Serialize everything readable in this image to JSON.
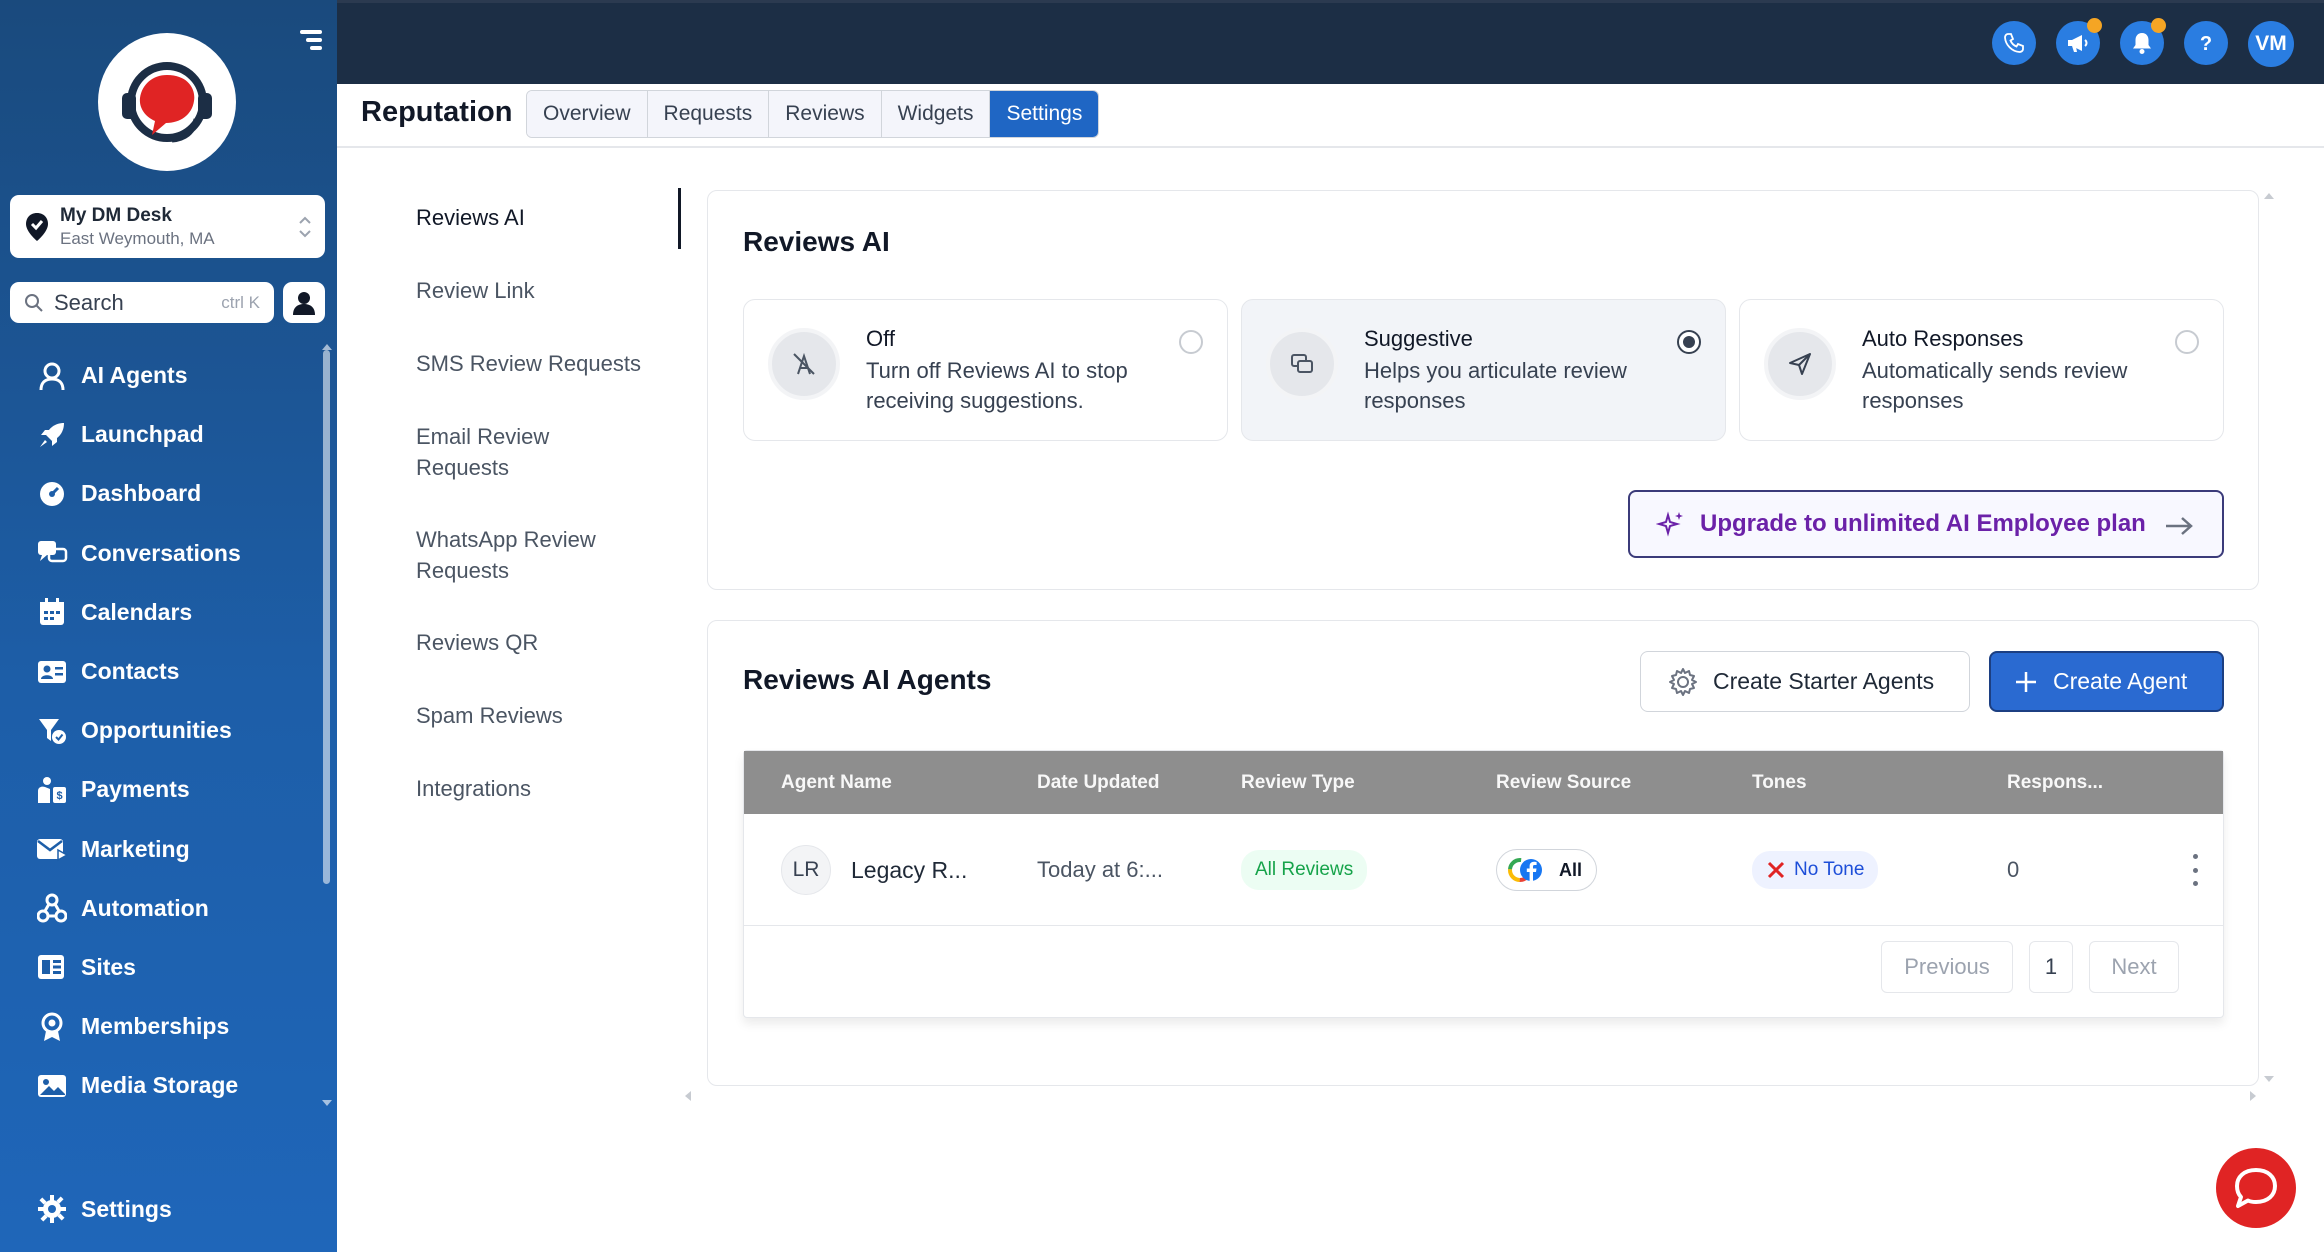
{
  "colors": {
    "sidebar": "#1d5ea8",
    "topbar": "#1c2e45",
    "accent": "#2a6ad1",
    "upgrade": "#6b21a8",
    "notify_dot": "#f5a524",
    "chat": "#e02424"
  },
  "sidebar": {
    "location": {
      "name": "My DM Desk",
      "city": "East Weymouth, MA"
    },
    "search": {
      "placeholder": "Search",
      "shortcut": "ctrl K"
    },
    "items": [
      {
        "label": "AI Agents",
        "icon": "ai-agent-icon"
      },
      {
        "label": "Launchpad",
        "icon": "rocket-icon"
      },
      {
        "label": "Dashboard",
        "icon": "gauge-icon"
      },
      {
        "label": "Conversations",
        "icon": "chat-icon"
      },
      {
        "label": "Calendars",
        "icon": "calendar-icon"
      },
      {
        "label": "Contacts",
        "icon": "contact-card-icon"
      },
      {
        "label": "Opportunities",
        "icon": "funnel-icon"
      },
      {
        "label": "Payments",
        "icon": "payments-icon"
      },
      {
        "label": "Marketing",
        "icon": "mail-icon"
      },
      {
        "label": "Automation",
        "icon": "workflow-icon"
      },
      {
        "label": "Sites",
        "icon": "sites-icon"
      },
      {
        "label": "Memberships",
        "icon": "badge-icon"
      },
      {
        "label": "Media Storage",
        "icon": "image-icon"
      }
    ],
    "settings_label": "Settings"
  },
  "topbar": {
    "avatar_initials": "VM"
  },
  "header": {
    "title": "Reputation",
    "tabs": [
      {
        "label": "Overview"
      },
      {
        "label": "Requests"
      },
      {
        "label": "Reviews"
      },
      {
        "label": "Widgets"
      },
      {
        "label": "Settings"
      }
    ]
  },
  "subnav": {
    "items": [
      "Reviews AI",
      "Review Link",
      "SMS Review Requests",
      "Email Review Requests",
      "WhatsApp Review Requests",
      "Reviews QR",
      "Spam Reviews",
      "Integrations"
    ]
  },
  "reviews_ai": {
    "title": "Reviews AI",
    "options": [
      {
        "title": "Off",
        "desc": "Turn off Reviews AI to stop receiving suggestions.",
        "selected": false
      },
      {
        "title": "Suggestive",
        "desc": "Helps you articulate review responses",
        "selected": true
      },
      {
        "title": "Auto Responses",
        "desc": "Automatically sends review responses",
        "selected": false
      }
    ],
    "upgrade_label": "Upgrade to unlimited AI Employee plan"
  },
  "agents": {
    "title": "Reviews AI Agents",
    "starter_label": "Create Starter Agents",
    "create_label": "Create Agent",
    "columns": [
      "Agent Name",
      "Date Updated",
      "Review Type",
      "Review Source",
      "Tones",
      "Respons..."
    ],
    "rows": [
      {
        "initials": "LR",
        "name": "Legacy R...",
        "date": "Today at 6:...",
        "type": "All Reviews",
        "source": "All",
        "tone": "No Tone",
        "responses": "0"
      }
    ],
    "pagination": {
      "previous": "Previous",
      "page": "1",
      "next": "Next"
    }
  }
}
